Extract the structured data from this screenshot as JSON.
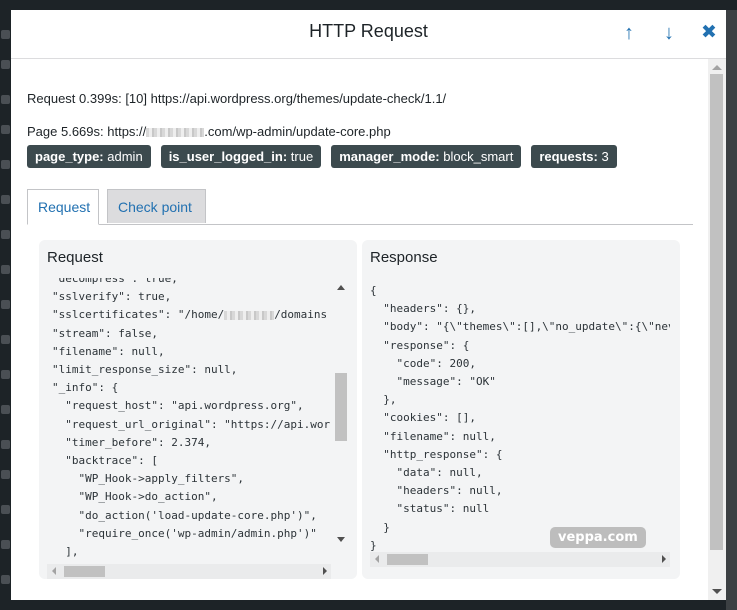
{
  "modal": {
    "title": "HTTP Request",
    "prev_icon": "arrow-up",
    "next_icon": "arrow-down",
    "close_icon": "close-x"
  },
  "info": {
    "request_label": "Request 0.399s:",
    "request_text": "[10] https://api.wordpress.org/themes/update-check/1.1/",
    "page_label": "Page 5.669s:",
    "page_url_prefix": "https://",
    "page_url_suffix": ".com/wp-admin/update-core.php"
  },
  "badges": [
    {
      "key": "page_type:",
      "value": "admin"
    },
    {
      "key": "is_user_logged_in:",
      "value": "true"
    },
    {
      "key": "manager_mode:",
      "value": "block_smart"
    },
    {
      "key": "requests:",
      "value": "3"
    }
  ],
  "tabs": [
    {
      "label": "Request",
      "active": true
    },
    {
      "label": "Check point",
      "active": false
    }
  ],
  "request_panel": {
    "title": "Request",
    "lines": [
      "\"decompress\": true,",
      "\"sslverify\": true,",
      "\"sslcertificates\": \"/home/",
      "\"stream\": false,",
      "\"filename\": null,",
      "\"limit_response_size\": null,",
      "\"_info\": {",
      "  \"request_host\": \"api.wordpress.org\",",
      "  \"request_url_original\": \"https://api.wor",
      "  \"timer_before\": 2.374,",
      "  \"backtrace\": [",
      "    \"WP_Hook->apply_filters\",",
      "    \"WP_Hook->do_action\",",
      "    \"do_action('load-update-core.php')\",",
      "    \"require_once('wp-admin/admin.php')\"",
      "  ],"
    ],
    "sslcertificates_suffix": "/domains"
  },
  "response_panel": {
    "title": "Response",
    "lines": [
      "{",
      "  \"headers\": {},",
      "  \"body\": \"{\\\"themes\\\":[],\\\"no_update\\\":{\\\"nev",
      "  \"response\": {",
      "    \"code\": 200,",
      "    \"message\": \"OK\"",
      "  },",
      "  \"cookies\": [],",
      "  \"filename\": null,",
      "  \"http_response\": {",
      "    \"data\": null,",
      "    \"headers\": null,",
      "    \"status\": null",
      "  }",
      "}"
    ]
  },
  "watermark": "veppa.com"
}
